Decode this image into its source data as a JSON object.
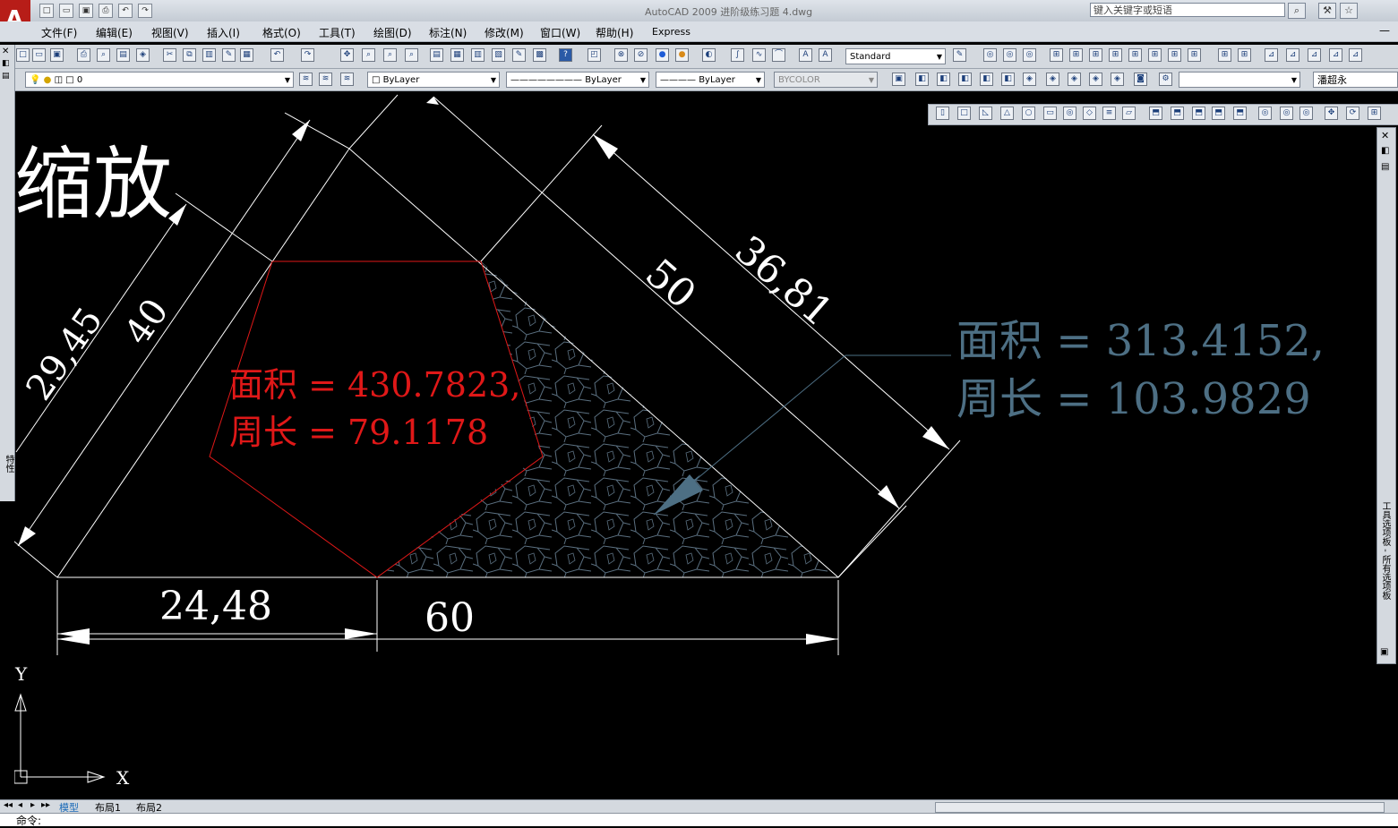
{
  "app": {
    "title": "AutoCAD 2009  进阶级练习题 4.dwg",
    "search_placeholder": "键入关键字或短语"
  },
  "menus": [
    "文件(F)",
    "编辑(E)",
    "视图(V)",
    "插入(I)",
    "格式(O)",
    "工具(T)",
    "绘图(D)",
    "标注(N)",
    "修改(M)",
    "窗口(W)",
    "帮助(H)",
    "Express"
  ],
  "toolbar": {
    "text_style": "Standard",
    "layer": "0",
    "color": "ByLayer",
    "linetype": "ByLayer",
    "lineweight": "ByLayer",
    "plot_style": "BYCOLOR",
    "user": "潘超永"
  },
  "drawing": {
    "heading": "缩放",
    "dims": {
      "d1": "29,45",
      "d2": "40",
      "d3": "50",
      "d4": "36,81",
      "d5": "24,48",
      "d6": "60"
    },
    "red_area_label": "面积 = 430.7823,",
    "red_perimeter_label": "周长 = 79.1178",
    "blue_area_label": "面积 = 313.4152,",
    "blue_perimeter_label": "周长 = 103.9829",
    "ucs_x": "X",
    "ucs_y": "Y"
  },
  "side": {
    "palette_label": "工具选项板 - 所有选项板",
    "props_label": "特性"
  },
  "tabs": [
    "模型",
    "布局1",
    "布局2"
  ],
  "command_prompt": "命令:",
  "colors": {
    "red": "#e01818",
    "blue": "#4d6f84",
    "white": "#ffffff",
    "background": "#000000"
  }
}
